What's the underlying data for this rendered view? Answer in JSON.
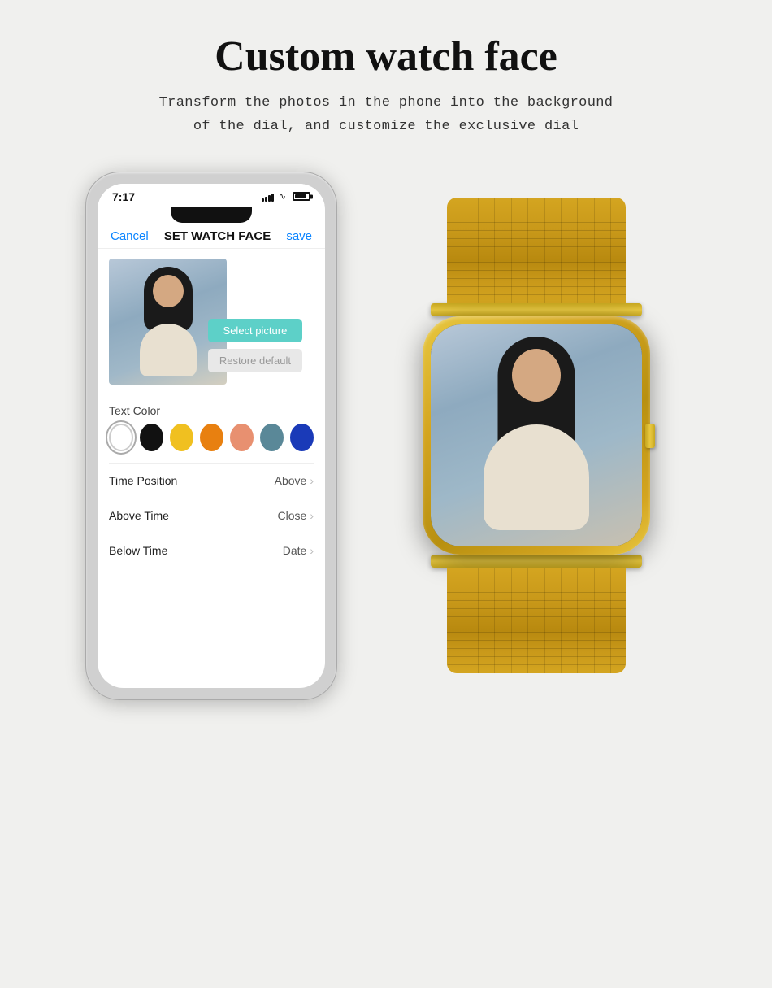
{
  "page": {
    "title": "Custom watch face",
    "subtitle_line1": "Transform the photos in the phone into the background",
    "subtitle_line2": "of the dial, and customize the exclusive dial"
  },
  "phone": {
    "time": "7:17",
    "nav": {
      "cancel": "Cancel",
      "title": "SET WATCH FACE",
      "save": "save"
    },
    "buttons": {
      "select_picture": "Select picture",
      "restore_default": "Restore default"
    },
    "text_color_label": "Text Color",
    "colors": [
      {
        "name": "white",
        "hex": "#ffffff",
        "selected": true
      },
      {
        "name": "black",
        "hex": "#111111",
        "selected": false
      },
      {
        "name": "yellow",
        "hex": "#f0c020",
        "selected": false
      },
      {
        "name": "orange",
        "hex": "#e88010",
        "selected": false
      },
      {
        "name": "peach",
        "hex": "#e89070",
        "selected": false
      },
      {
        "name": "teal",
        "hex": "#5a8898",
        "selected": false
      },
      {
        "name": "blue",
        "hex": "#1a3ab8",
        "selected": false
      }
    ],
    "settings": [
      {
        "label": "Time Position",
        "value": "Above"
      },
      {
        "label": "Above Time",
        "value": "Close"
      },
      {
        "label": "Below Time",
        "value": "Date"
      }
    ]
  }
}
